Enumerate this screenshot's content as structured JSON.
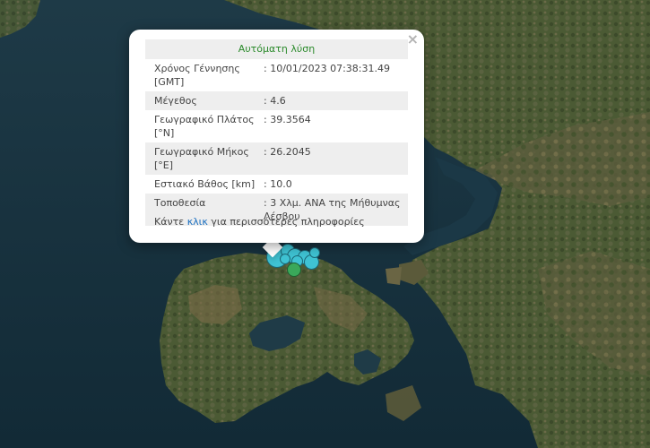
{
  "popup": {
    "title": "Αυτόματη λύση",
    "close_symbol": "×",
    "rows": [
      {
        "label": "Χρόνος Γέννησης [GMT]",
        "value": ": 10/01/2023 07:38:31.49"
      },
      {
        "label": "Μέγεθος",
        "value": ": 4.6"
      },
      {
        "label": "Γεωγραφικό Πλάτος [°N]",
        "value": ": 39.3564"
      },
      {
        "label": "Γεωγραφικό Μήκος [°E]",
        "value": ": 26.2045"
      },
      {
        "label": "Εστιακό Βάθος [km]",
        "value": ": 10.0"
      },
      {
        "label": "Τοποθεσία",
        "value": ": 3 Χλμ. ΑΝΑ της Μήθυμνας Λέσβου"
      }
    ],
    "footer_before": "Κάντε ",
    "footer_link": "κλικ",
    "footer_after": " για περισσότερες πληροφορίες"
  },
  "map": {
    "sea_color": "#16303d",
    "land_color": "#4a5a35",
    "marker_colors": {
      "automatic": "#3fc3d3",
      "manual": "#3aa85a"
    }
  }
}
